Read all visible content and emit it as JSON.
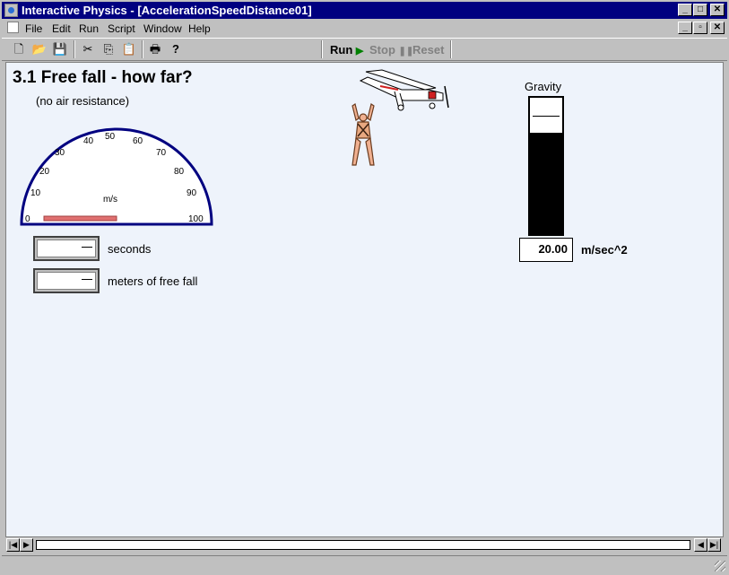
{
  "window": {
    "title": "Interactive Physics - [AccelerationSpeedDistance01]",
    "controls": [
      "_",
      "□",
      "✕"
    ],
    "doc_controls": [
      "_",
      "▫",
      "✕"
    ]
  },
  "menu": [
    "File",
    "Edit",
    "Run",
    "Script",
    "Window",
    "Help"
  ],
  "toolbar": {
    "icons": [
      "new-icon",
      "open-icon",
      "save-icon",
      "cut-icon",
      "copy-icon",
      "paste-icon",
      "print-icon",
      "help-icon"
    ],
    "run_label": "Run",
    "stop_label": "Stop",
    "reset_label": "Reset"
  },
  "sim": {
    "heading": "3.1 Free fall - how far?",
    "subheading": "(no air resistance)",
    "gauge": {
      "unit": "m/s",
      "ticks": [
        "0",
        "10",
        "20",
        "30",
        "40",
        "50",
        "60",
        "70",
        "80",
        "90",
        "100"
      ],
      "reading": 0
    },
    "seconds_label": "seconds",
    "meters_label": "meters of free fall",
    "gravity": {
      "title": "Gravity",
      "value": "20.00",
      "unit": "m/sec^2",
      "fraction": 0.75
    }
  },
  "colors": {
    "titlebar": "#000080",
    "gauge_rim": "#000080",
    "gauge_needle": "#e07070",
    "workspace_bg": "#eef3fb",
    "run_arrow": "#008000"
  }
}
